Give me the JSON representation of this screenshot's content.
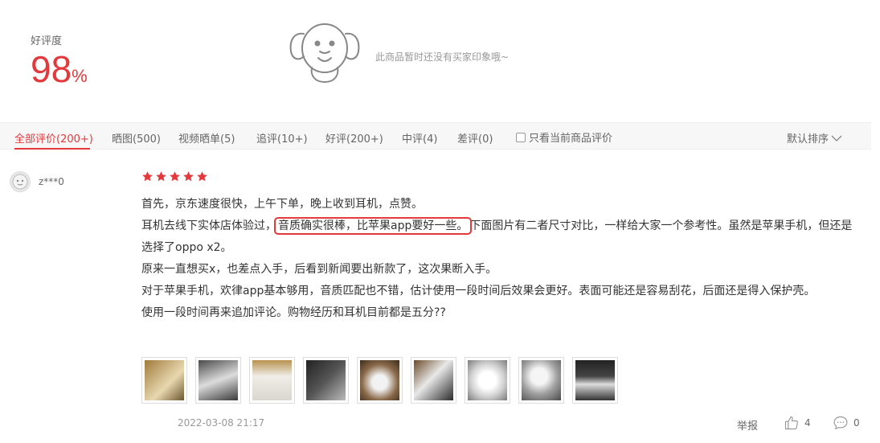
{
  "rating": {
    "label": "好评度",
    "value": "98",
    "unit": "%"
  },
  "impression": {
    "empty_text": "此商品暂时还没有买家印象哦~"
  },
  "tabs": [
    {
      "label": "全部评价(200+)",
      "active": true
    },
    {
      "label": "晒图(500)"
    },
    {
      "label": "视频晒单(5)"
    },
    {
      "label": "追评(10+)"
    },
    {
      "label": "好评(200+)"
    },
    {
      "label": "中评(4)"
    },
    {
      "label": "差评(0)"
    }
  ],
  "filter": {
    "only_current_label": "只看当前商品评价",
    "sort_label": "默认排序"
  },
  "review": {
    "username": "z***0",
    "stars": 5,
    "lines": {
      "l1": "首先，京东速度很快，上午下单，晚上收到耳机，点赞。",
      "l2_pre": "耳机去线下实体店体验过，",
      "l2_highlight": "音质确实很棒，比苹果app要好一些。",
      "l2_post": "下面图片有二者尺寸对比，一样给大家一个参考性。虽然是苹果手机，但还是选择了oppo x2。",
      "l3": "原来一直想买x，也差点入手，后看到新闻要出新款了，这次果断入手。",
      "l4": "对于苹果手机，欢律app基本够用，音质匹配也不错，估计使用一段时间后效果会更好。表面可能还是容易刮花，后面还是得入保护壳。",
      "l5": "使用一段时间再来追加评论。购物经历和耳机目前都是五分??"
    },
    "photo_count": 9,
    "date": "2022-03-08 21:17",
    "report_label": "举报",
    "likes": "4",
    "replies": "0"
  },
  "colors": {
    "accent": "#e4393c",
    "star": "#e4393c"
  }
}
